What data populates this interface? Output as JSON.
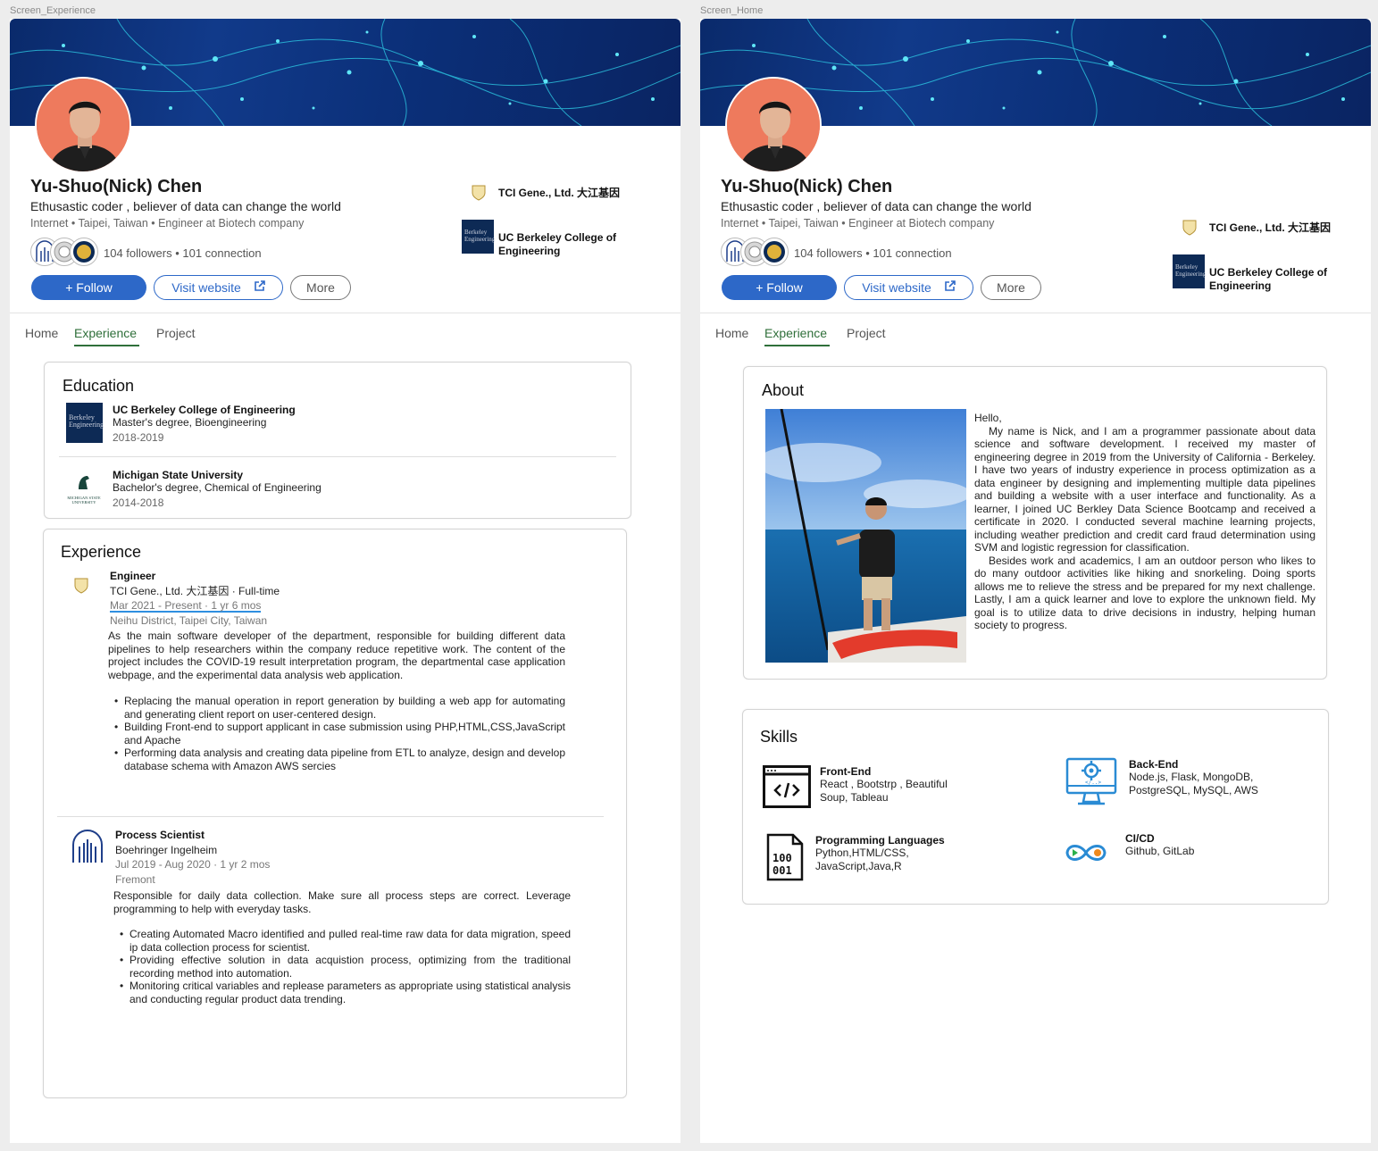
{
  "screens": {
    "experience": {
      "frame_label": "Screen_Experience"
    },
    "home": {
      "frame_label": "Screen_Home"
    }
  },
  "profile": {
    "name": "Yu-Shuo(Nick) Chen",
    "headline": "Ethusastic coder , believer of data can change the world",
    "meta": "Internet • Taipei, Taiwan • Engineer at Biotech company",
    "followers": "104 followers • 101 connection",
    "company_current": "TCI Gene., Ltd. 大江基因",
    "school": "UC Berkeley College of Engineering",
    "school_logo_text": "Berkeley Engineering"
  },
  "actions": {
    "follow": "+ Follow",
    "visit": "Visit website",
    "more": "More"
  },
  "tabs": [
    "Home",
    "Experience",
    "Project"
  ],
  "education": {
    "title": "Education",
    "items": [
      {
        "school": "UC Berkeley College of Engineering",
        "degree": "Master's degree, Bioengineering",
        "years": "2018-2019"
      },
      {
        "school": "Michigan State University",
        "degree": "Bachelor's degree, Chemical of Engineering",
        "years": "2014-2018",
        "logo_text": "MICHIGAN STATE UNIVERSITY"
      }
    ]
  },
  "experience": {
    "title": "Experience",
    "jobs": [
      {
        "title": "Engineer",
        "company": "TCI Gene., Ltd. 大江基因 · Full-time",
        "dates": "Mar 2021 - Present · 1 yr 6 mos",
        "location": "Neihu District, Taipei City, Taiwan",
        "description": "As the main software developer of the department, responsible for building different data pipelines to help researchers within the company reduce repetitive work. The content of the project includes the COVID-19 result interpretation program, the departmental case application webpage, and the experimental data analysis web application.",
        "bullets": [
          "Replacing  the manual operation in report generation by building a web app for automating and generating client report on user-centered design.",
          "Building Front-end to support applicant in case submission using PHP,HTML,CSS,JavaScript and Apache",
          "Performing data analysis and creating data pipeline from ETL to analyze, design and develop database schema with Amazon AWS sercies"
        ]
      },
      {
        "title": "Process Scientist",
        "company": "Boehringer Ingelheim",
        "dates": "Jul 2019 - Aug 2020 · 1 yr 2 mos",
        "location": "Fremont",
        "description": "Responsible for daily data collection. Make sure all process steps are correct. Leverage programming to help with everyday tasks.",
        "bullets": [
          "Creating Automated Macro identified and pulled real-time raw data for data migration, speed ip data collection process for scientist.",
          "Providing effective solution in data acquistion process, optimizing from the traditional recording method into automation.",
          "Monitoring critical variables and replease parameters as appropriate using statistical analysis and conducting regular product data trending."
        ]
      }
    ]
  },
  "about": {
    "title": "About",
    "greeting": "Hello,",
    "paragraphs": [
      "My name is Nick, and I am a programmer passionate about data science and software development. I received my master of engineering degree in 2019 from the University of California - Berkeley. I have two years of industry experience in process optimization as a data engineer by designing and implementing multiple data pipelines and building a website with a user interface and functionality. As a learner, I joined UC Berkley Data Science Bootcamp and received a certificate in 2020. I conducted several machine learning projects, including weather prediction and credit card fraud determination using SVM and logistic regression for classification.",
      "Besides work and academics, I am an outdoor person who likes to do many outdoor activities like hiking and snorkeling. Doing sports allows me to relieve the stress and be prepared for my next challenge. Lastly, I am a quick learner and love to explore the unknown field. My goal is to utilize data to drive decisions in industry, helping human society to progress."
    ]
  },
  "skills": {
    "title": "Skills",
    "items": [
      {
        "name": "Front-End",
        "desc": "React , Bootstrp , Beautiful Soup, Tableau",
        "icon": "code-window-icon"
      },
      {
        "name": "Back-End",
        "desc": "Node.js, Flask, MongoDB, PostgreSQL, MySQL, AWS",
        "icon": "monitor-gear-icon"
      },
      {
        "name": "Programming Languages",
        "desc": "Python,HTML/CSS, JavaScript,Java,R",
        "icon": "binary-file-icon"
      },
      {
        "name": "CI/CD",
        "desc": "Github, GitLab",
        "icon": "infinity-loop-icon"
      }
    ]
  },
  "colors": {
    "primary": "#2d68c8",
    "tab_active": "#2f6f3a",
    "banner": "#0b2f78",
    "avatar_bg": "#ee7a5d",
    "berkeley_navy": "#0d2a55",
    "msu_green": "#18453b"
  }
}
